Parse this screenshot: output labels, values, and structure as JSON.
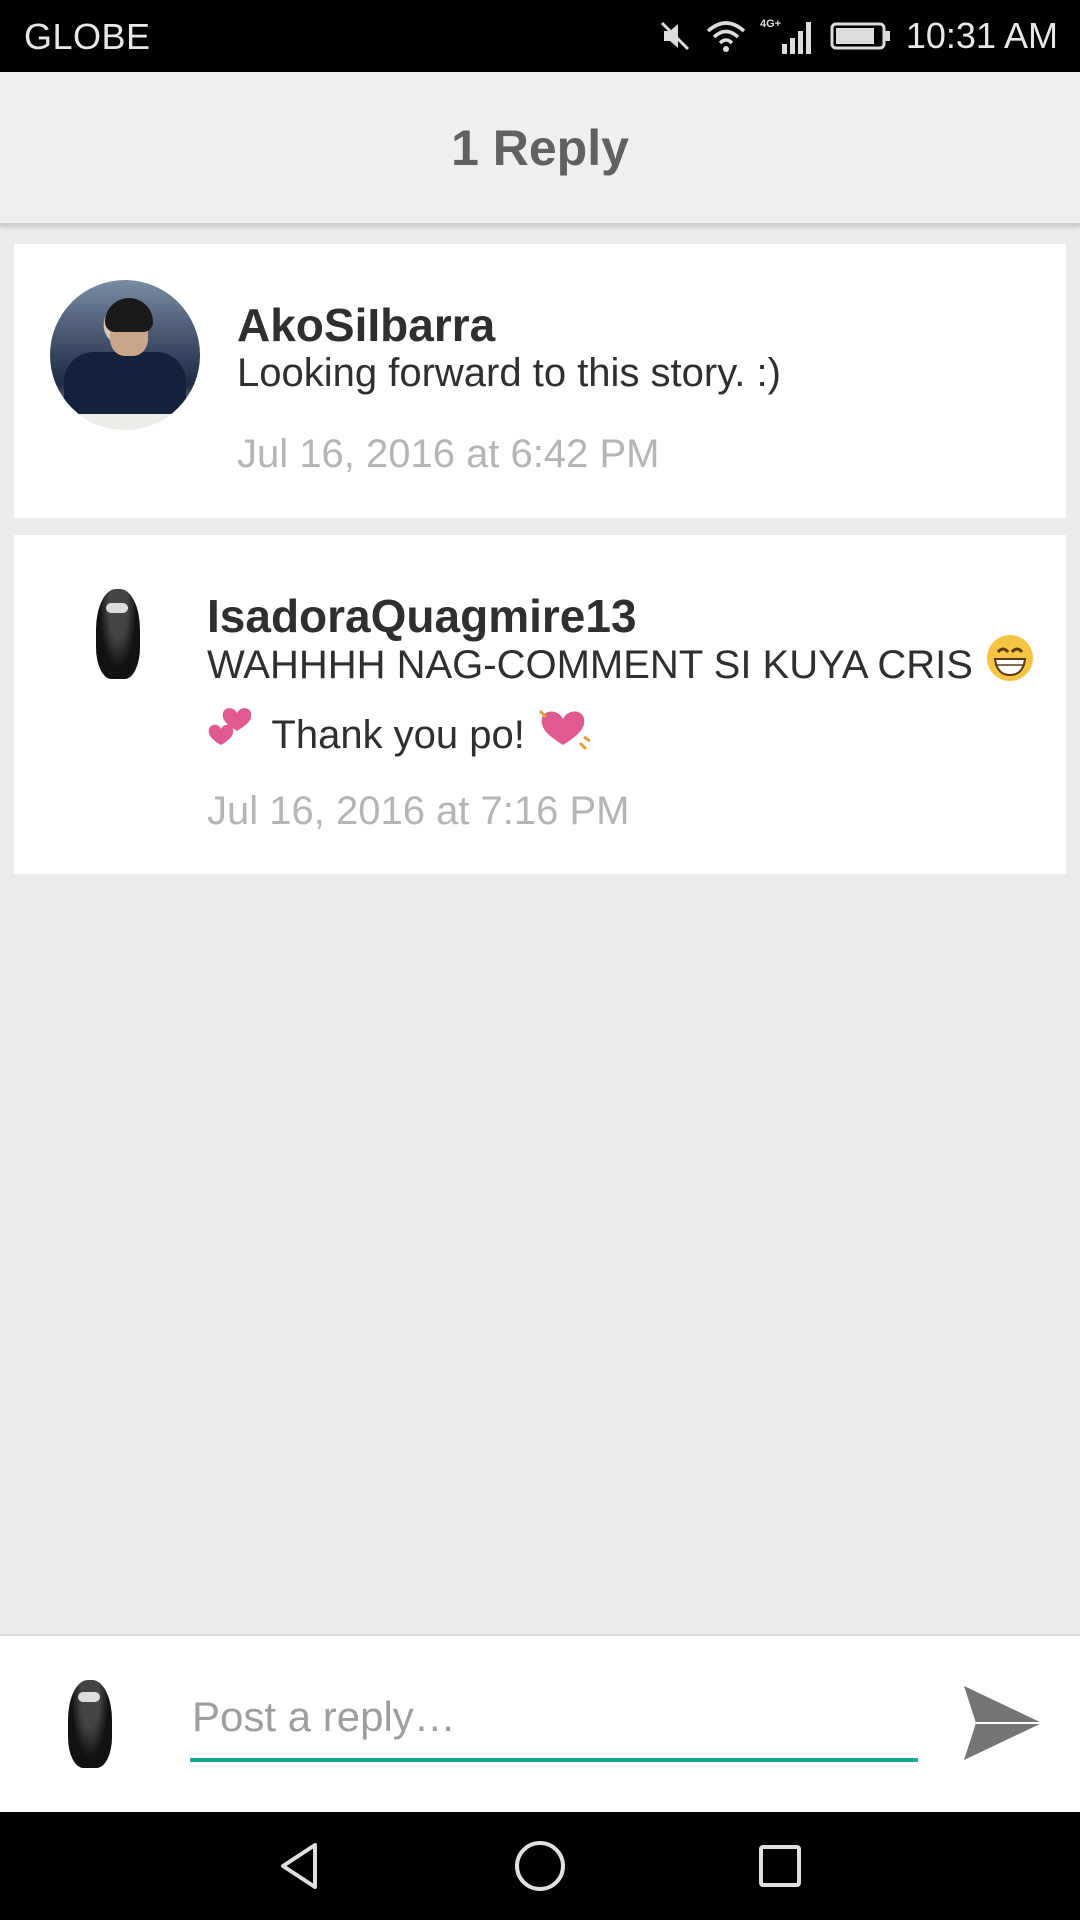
{
  "status_bar": {
    "carrier": "GLOBE",
    "time": "10:31 AM",
    "network_label": "4G+",
    "icons": [
      "mute-icon",
      "wifi-icon",
      "signal-icon",
      "battery-icon"
    ]
  },
  "header": {
    "title": "1 Reply"
  },
  "comments": [
    {
      "username": "AkoSiIbarra",
      "message": "Looking forward to this story. :)",
      "timestamp": "Jul 16, 2016 at 6:42 PM"
    },
    {
      "username": "IsadoraQuagmire13",
      "message_part1": "WAHHHH NAG-COMMENT SI KUYA CRIS",
      "message_part2": "Thank you po!",
      "timestamp": "Jul 16, 2016 at 7:16 PM",
      "emojis": [
        "grinning-face-emoji",
        "two-hearts-emoji",
        "beating-heart-emoji"
      ]
    }
  ],
  "reply": {
    "placeholder": "Post a reply…",
    "send_icon": "send-icon"
  },
  "nav": {
    "icons": [
      "back-icon",
      "home-icon",
      "recents-icon"
    ]
  },
  "colors": {
    "accent": "#11a79a",
    "header_bg": "#efefef",
    "page_bg": "#ececec",
    "timestamp": "#b5b5b5",
    "heart": "#e05a8f"
  }
}
